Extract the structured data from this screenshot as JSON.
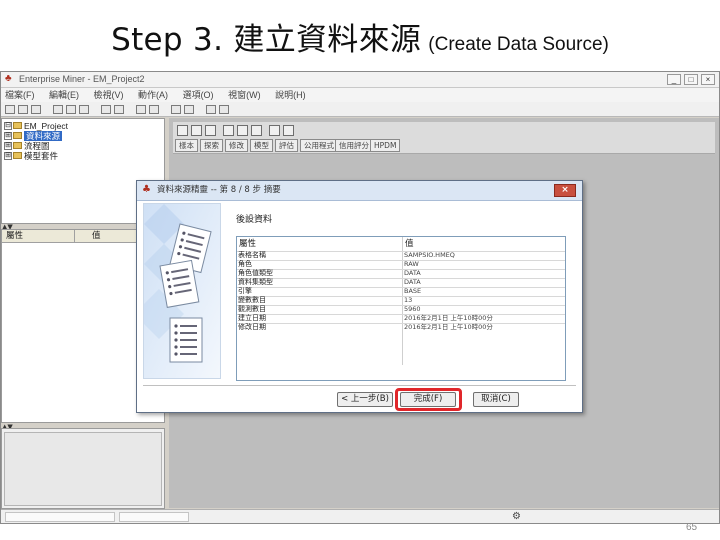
{
  "slide": {
    "title_main": "Step 3. 建立資料來源",
    "title_sub": "(Create Data Source)",
    "page_number": "65"
  },
  "app": {
    "window_title": "Enterprise Miner - EM_Project2",
    "window_controls": [
      "_",
      "□",
      "×"
    ],
    "menu": [
      "檔案(F)",
      "編輯(E)",
      "檢視(V)",
      "動作(A)",
      "選項(O)",
      "視窗(W)",
      "說明(H)"
    ]
  },
  "tree": {
    "items": [
      {
        "label": "EM_Project",
        "expander": "⊟",
        "selected": false
      },
      {
        "label": "資料來源",
        "expander": "⊞",
        "selected": true
      },
      {
        "label": "流程圖",
        "expander": "⊞",
        "selected": false
      },
      {
        "label": "模型套件",
        "expander": "⊞",
        "selected": false
      }
    ]
  },
  "properties": {
    "col_property": "屬性",
    "col_value": "值"
  },
  "diagram": {
    "node_tabs": [
      "樣本",
      "探索",
      "修改",
      "模型",
      "評估",
      "公用程式",
      "信用評分",
      "HPDM"
    ]
  },
  "wizard": {
    "title": "資料來源精靈 -- 第 8 / 8 步 摘要",
    "close": "×",
    "section_label": "後設資料",
    "table": {
      "headers": [
        "屬性",
        "值"
      ],
      "rows": [
        {
          "key": "表格名稱",
          "value": "SAMPSIO.HMEQ"
        },
        {
          "key": "角色",
          "value": "RAW"
        },
        {
          "key": "角色值類型",
          "value": "DATA"
        },
        {
          "key": "資料集類型",
          "value": "DATA"
        },
        {
          "key": "引擎",
          "value": "BASE"
        },
        {
          "key": "變數數目",
          "value": "13"
        },
        {
          "key": "觀測數目",
          "value": "5960"
        },
        {
          "key": "建立日期",
          "value": "2016年2月1日 上午10時00分"
        },
        {
          "key": "修改日期",
          "value": "2016年2月1日 上午10時00分"
        }
      ]
    },
    "buttons": {
      "back": "< 上一步(B)",
      "finish": "完成(F)",
      "cancel": "取消(C)"
    }
  },
  "colors": {
    "highlight": "#e0262a",
    "selection": "#316ac5",
    "wizard_titlebar": "#dbe6f4",
    "app_background": "#d4d0c8"
  },
  "icons": [
    "app-icon",
    "folder-icon",
    "new-icon",
    "open-icon",
    "save-icon",
    "run-icon",
    "stop-icon",
    "settings-gear-icon",
    "document-stack-illustration"
  ]
}
